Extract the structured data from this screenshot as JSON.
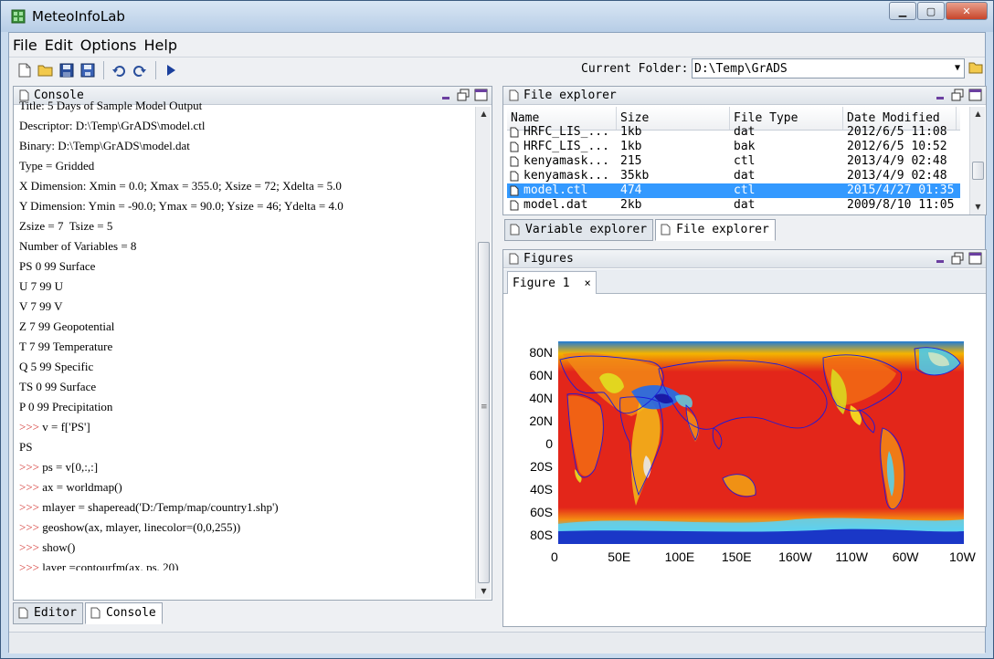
{
  "app": {
    "title": "MeteoInfoLab"
  },
  "menu": [
    "File",
    "Edit",
    "Options",
    "Help"
  ],
  "toolbar": {
    "icons": [
      "new-file-icon",
      "open-folder-icon",
      "save-icon",
      "save-all-icon",
      "undo-icon",
      "redo-icon",
      "run-icon"
    ],
    "current_folder_label": "Current Folder:",
    "current_folder_value": "D:\\Temp\\GrADS"
  },
  "console": {
    "title": "Console",
    "lines": [
      {
        "prompt": "",
        "text": "Title: 5 Days of Sample Model Output"
      },
      {
        "prompt": "",
        "text": "Descriptor: D:\\Temp\\GrADS\\model.ctl"
      },
      {
        "prompt": "",
        "text": "Binary: D:\\Temp\\GrADS\\model.dat"
      },
      {
        "prompt": "",
        "text": "Type = Gridded"
      },
      {
        "prompt": "",
        "text": "X Dimension: Xmin = 0.0; Xmax = 355.0; Xsize = 72; Xdelta = 5.0"
      },
      {
        "prompt": "",
        "text": "Y Dimension: Ymin = -90.0; Ymax = 90.0; Ysize = 46; Ydelta = 4.0"
      },
      {
        "prompt": "",
        "text": "Zsize = 7  Tsize = 5"
      },
      {
        "prompt": "",
        "text": "Number of Variables = 8"
      },
      {
        "prompt": "",
        "text": "PS 0 99 Surface"
      },
      {
        "prompt": "",
        "text": "U 7 99 U"
      },
      {
        "prompt": "",
        "text": "V 7 99 V"
      },
      {
        "prompt": "",
        "text": "Z 7 99 Geopotential"
      },
      {
        "prompt": "",
        "text": "T 7 99 Temperature"
      },
      {
        "prompt": "",
        "text": "Q 5 99 Specific"
      },
      {
        "prompt": "",
        "text": "TS 0 99 Surface"
      },
      {
        "prompt": "",
        "text": "P 0 99 Precipitation"
      },
      {
        "prompt": ">>>",
        "text": "v = f['PS']"
      },
      {
        "prompt": "",
        "text": "PS"
      },
      {
        "prompt": ">>>",
        "text": "ps = v[0,:,:]"
      },
      {
        "prompt": ">>>",
        "text": "ax = worldmap()"
      },
      {
        "prompt": ">>>",
        "text": "mlayer = shaperead('D:/Temp/map/country1.shp')"
      },
      {
        "prompt": ">>>",
        "text": "geoshow(ax, mlayer, linecolor=(0,0,255))"
      },
      {
        "prompt": ">>>",
        "text": "show()"
      },
      {
        "prompt": ">>>",
        "text": "layer =contourfm(ax, ps, 20)"
      },
      {
        "prompt": ">>>",
        "text": ""
      }
    ],
    "tabs": [
      "Editor",
      "Console"
    ]
  },
  "file_explorer": {
    "title": "File explorer",
    "columns": [
      "Name",
      "Size",
      "File Type",
      "Date Modified"
    ],
    "rows": [
      [
        "HRFC_LIS_...",
        "1kb",
        "dat",
        "2012/6/5 11:08"
      ],
      [
        "HRFC_LIS_...",
        "1kb",
        "bak",
        "2012/6/5 10:52"
      ],
      [
        "kenyamask...",
        "215",
        "ctl",
        "2013/4/9 02:48"
      ],
      [
        "kenyamask...",
        "35kb",
        "dat",
        "2013/4/9 02:48"
      ],
      [
        "model.ctl",
        "474",
        "ctl",
        "2015/4/27 01:35"
      ],
      [
        "model.dat",
        "2kb",
        "dat",
        "2009/8/10 11:05"
      ]
    ],
    "selected_index": 4,
    "tabs": [
      "Variable explorer",
      "File explorer"
    ]
  },
  "figures": {
    "title": "Figures",
    "tab": "Figure 1",
    "tab_close": "×",
    "lat_ticks": [
      "80N",
      "60N",
      "40N",
      "20N",
      "0",
      "20S",
      "40S",
      "60S",
      "80S"
    ],
    "lon_ticks": [
      "0",
      "50E",
      "100E",
      "150E",
      "160W",
      "110W",
      "60W",
      "10W"
    ]
  },
  "colors": {
    "accent": "#3399ff",
    "prompt": "#d2302c",
    "coastline": "#1a1adc"
  }
}
